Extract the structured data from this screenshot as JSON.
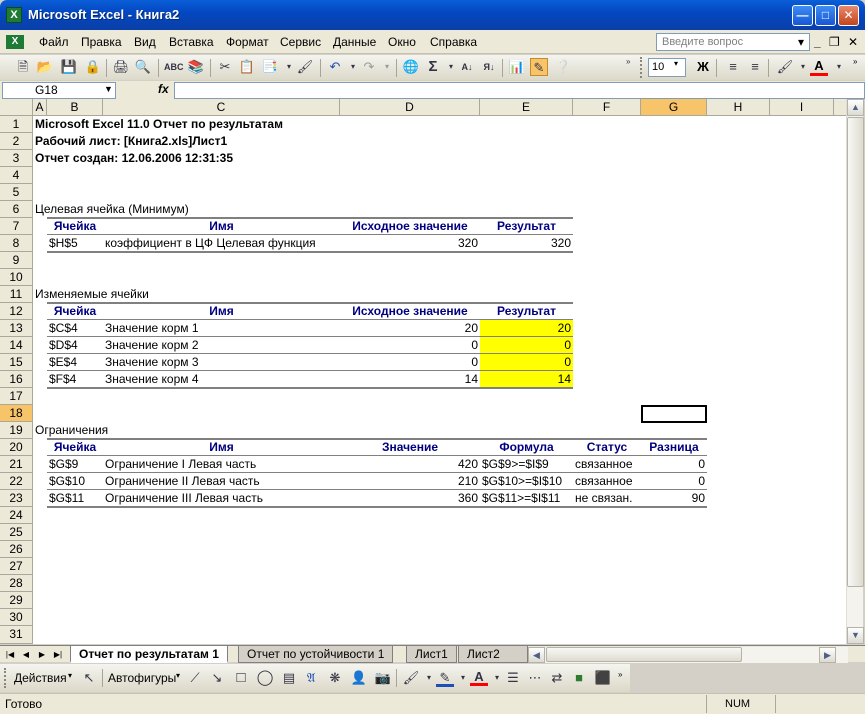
{
  "window": {
    "title": "Microsoft Excel - Книга2",
    "app_icon": "X"
  },
  "menu": {
    "items": [
      "Файл",
      "Правка",
      "Вид",
      "Вставка",
      "Формат",
      "Сервис",
      "Данные",
      "Окно",
      "Справка"
    ],
    "help_placeholder": "Введите вопрос"
  },
  "toolbar": {
    "font_size": "10",
    "bold": "Ж",
    "font_color_letter": "А"
  },
  "formula_bar": {
    "name_box": "G18",
    "fx": "fx",
    "formula": ""
  },
  "columns": [
    "A",
    "B",
    "C",
    "D",
    "E",
    "F",
    "G",
    "H",
    "I"
  ],
  "rows": [
    "1",
    "2",
    "3",
    "4",
    "5",
    "6",
    "7",
    "8",
    "9",
    "10",
    "11",
    "12",
    "13",
    "14",
    "15",
    "16",
    "17",
    "18",
    "19",
    "20",
    "21",
    "22",
    "23",
    "24",
    "25",
    "26",
    "27",
    "28",
    "29",
    "30",
    "31"
  ],
  "report": {
    "line1": "Microsoft Excel 11.0 Отчет по результатам",
    "line2": "Рабочий лист: [Книга2.xls]Лист1",
    "line3": "Отчет создан: 12.06.2006 12:31:35",
    "target": {
      "title": "Целевая ячейка (Минимум)",
      "headers": [
        "Ячейка",
        "Имя",
        "Исходное значение",
        "Результат"
      ],
      "rows": [
        {
          "cell": "$H$5",
          "name": "коэффициент в ЦФ Целевая функция",
          "initial": "320",
          "result": "320"
        }
      ]
    },
    "changing": {
      "title": "Изменяемые ячейки",
      "headers": [
        "Ячейка",
        "Имя",
        "Исходное значение",
        "Результат"
      ],
      "rows": [
        {
          "cell": "$C$4",
          "name": "Значение корм 1",
          "initial": "20",
          "result": "20"
        },
        {
          "cell": "$D$4",
          "name": "Значение корм 2",
          "initial": "0",
          "result": "0"
        },
        {
          "cell": "$E$4",
          "name": "Значение корм 3",
          "initial": "0",
          "result": "0"
        },
        {
          "cell": "$F$4",
          "name": "Значение корм 4",
          "initial": "14",
          "result": "14"
        }
      ]
    },
    "constraints": {
      "title": "Ограничения",
      "headers": [
        "Ячейка",
        "Имя",
        "Значение",
        "Формула",
        "Статус",
        "Разница"
      ],
      "rows": [
        {
          "cell": "$G$9",
          "name": "Ограничение I Левая часть",
          "value": "420",
          "formula": "$G$9>=$I$9",
          "status": "связанное",
          "diff": "0"
        },
        {
          "cell": "$G$10",
          "name": "Ограничение II Левая часть",
          "value": "210",
          "formula": "$G$10>=$I$10",
          "status": "связанное",
          "diff": "0"
        },
        {
          "cell": "$G$11",
          "name": "Ограничение III Левая часть",
          "value": "360",
          "formula": "$G$11>=$I$11",
          "status": "не связан.",
          "diff": "90"
        }
      ]
    }
  },
  "sheet_tabs": [
    "Отчет по результатам 1",
    "Отчет по устойчивости 1",
    "Лист1",
    "Лист2"
  ],
  "drawing_toolbar": {
    "actions": "Действия",
    "autoshapes": "Автофигуры"
  },
  "status": {
    "left": "Готово",
    "num": "NUM"
  },
  "colors": {
    "highlight": "#ffff00",
    "header_text": "#000080",
    "selected_header": "#f8c46a"
  }
}
